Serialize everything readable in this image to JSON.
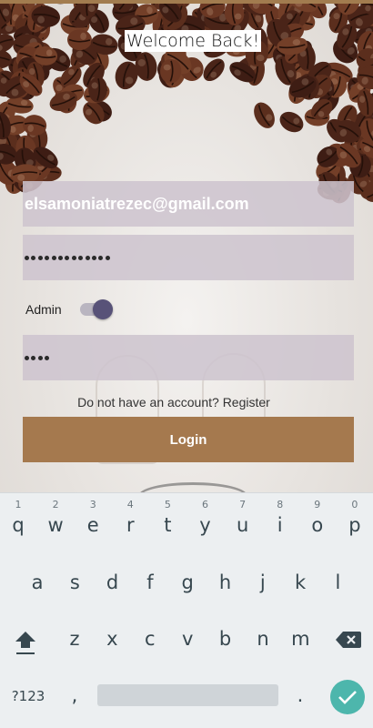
{
  "app": {
    "title": "Welcome Back!"
  },
  "form": {
    "email_value": "elsamoniatrezec@gmail.com",
    "password_length": 13,
    "admin_label": "Admin",
    "admin_enabled": true,
    "admin_field_length": 4,
    "register_text": "Do not have an account? Register",
    "login_label": "Login"
  },
  "keyboard": {
    "row1": [
      {
        "k": "q",
        "h": "1"
      },
      {
        "k": "w",
        "h": "2"
      },
      {
        "k": "e",
        "h": "3"
      },
      {
        "k": "r",
        "h": "4"
      },
      {
        "k": "t",
        "h": "5"
      },
      {
        "k": "y",
        "h": "6"
      },
      {
        "k": "u",
        "h": "7"
      },
      {
        "k": "i",
        "h": "8"
      },
      {
        "k": "o",
        "h": "9"
      },
      {
        "k": "p",
        "h": "0"
      }
    ],
    "row2": [
      "a",
      "s",
      "d",
      "f",
      "g",
      "h",
      "j",
      "k",
      "l"
    ],
    "row3": [
      "z",
      "x",
      "c",
      "v",
      "b",
      "n",
      "m"
    ],
    "symbols_label": "?123",
    "comma": ",",
    "period": ".",
    "icons": {
      "shift": "shift-arrow-icon",
      "backspace": "backspace-icon",
      "done": "checkmark-icon"
    }
  },
  "colors": {
    "accent": "#a5794e",
    "field_bg": "#cdc4ce",
    "switch_thumb": "#585278",
    "done_key": "#4db6ac"
  }
}
